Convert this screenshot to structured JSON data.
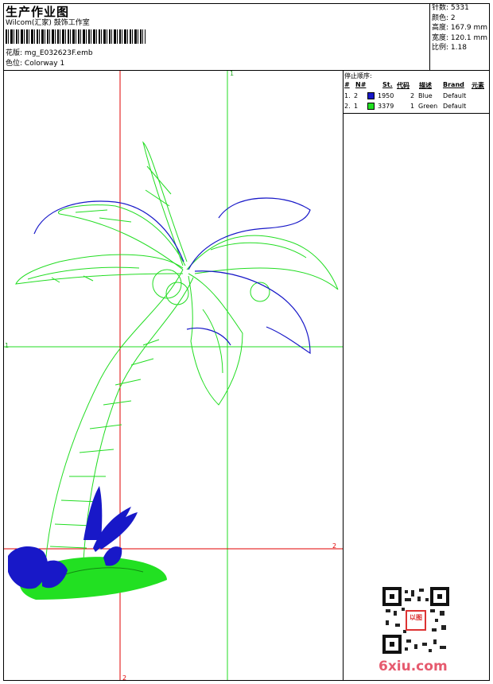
{
  "header": {
    "title": "生产作业图",
    "company": "Wilcom(汇家) 鼓饰工作室",
    "design_label": "花版:",
    "design_file": "mg_E032623F.emb",
    "colorway_label": "色位:",
    "colorway": "Colorway 1"
  },
  "stats": {
    "stitches": "针数: 5331",
    "colors": "颜色: 2",
    "height": "高度: 167.9 mm",
    "width": "宽度: 120.1 mm",
    "scale": "比例: 1.18"
  },
  "stop_sequence": {
    "title": "停止顺序:",
    "headers": [
      "#",
      "N#",
      "St.",
      "代码",
      "描述",
      "Brand",
      "元素"
    ],
    "rows": [
      {
        "index": "1.",
        "needle": "2",
        "stitches": "1950",
        "code": "2",
        "desc": "Blue",
        "brand": "Default",
        "color": "#1818c8"
      },
      {
        "index": "2.",
        "needle": "1",
        "stitches": "3379",
        "code": "1",
        "desc": "Green",
        "brand": "Default",
        "color": "#22e022"
      }
    ]
  },
  "guides": {
    "green_v": "1",
    "green_h": "1",
    "red_v": "2",
    "red_h": "2"
  },
  "colors": {
    "blue": "#1818c8",
    "green": "#22dd22",
    "red": "#e00000",
    "brand_pink": "#e65a6e"
  },
  "watermark": {
    "site": "6xiu.com",
    "seal": "以图"
  }
}
